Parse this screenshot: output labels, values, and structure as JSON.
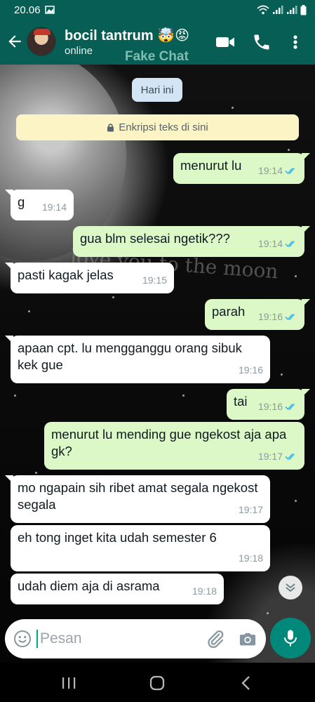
{
  "status_bar": {
    "time": "20.06"
  },
  "header": {
    "contact_name": "bocil tantrum 🤯😡",
    "contact_status": "online",
    "watermark": "Fake Chat"
  },
  "wallpaper": {
    "text": "love you to the moon"
  },
  "chat": {
    "date_chip": "Hari ini",
    "encryption_notice": "Enkripsi teks di sini",
    "messages": [
      {
        "dir": "out",
        "text": "menurut lu",
        "time": "19:14"
      },
      {
        "dir": "in",
        "text": "g",
        "time": "19:14"
      },
      {
        "dir": "out",
        "text": "gua blm selesai ngetik???",
        "time": "19:14"
      },
      {
        "dir": "in",
        "text": "pasti kagak jelas",
        "time": "19:15"
      },
      {
        "dir": "out",
        "text": "parah",
        "time": "19:16"
      },
      {
        "dir": "in",
        "text": "apaan cpt. lu mengganggu orang sibuk kek gue",
        "time": "19:16"
      },
      {
        "dir": "out",
        "text": "tai",
        "time": "19:16"
      },
      {
        "dir": "out",
        "text": "menurut lu mending gue ngekost aja apa gk?",
        "time": "19:17"
      },
      {
        "dir": "in",
        "text": "mo ngapain sih ribet amat segala ngekost segala",
        "time": "19:17"
      },
      {
        "dir": "in",
        "text": "eh tong inget kita udah semester 6",
        "time": "19:18"
      },
      {
        "dir": "in",
        "text": "udah diem aja di asrama",
        "time": "19:18"
      }
    ]
  },
  "input": {
    "placeholder": "Pesan",
    "value": ""
  },
  "colors": {
    "header": "#075e54",
    "outgoing_bubble": "#dcf8c6",
    "incoming_bubble": "#ffffff",
    "accent": "#00897b",
    "read_tick": "#34b7f1"
  },
  "icons": [
    "back-arrow-icon",
    "video-call-icon",
    "phone-call-icon",
    "more-options-icon",
    "lock-icon",
    "emoji-icon",
    "attach-icon",
    "camera-icon",
    "mic-icon",
    "scroll-down-icon",
    "read-receipt-icon"
  ]
}
